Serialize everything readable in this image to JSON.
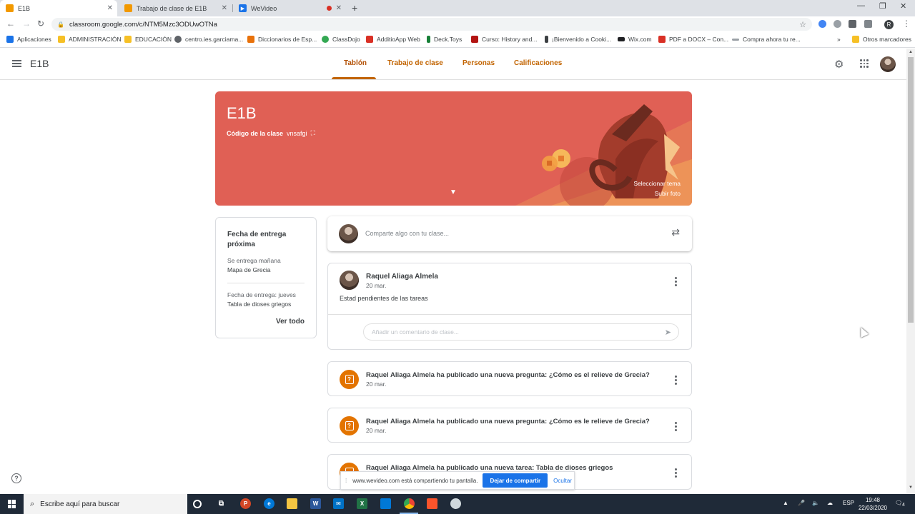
{
  "browser": {
    "tabs": [
      {
        "title": "E1B",
        "active": true,
        "favicon_color": "#f29900"
      },
      {
        "title": "Trabajo de clase de E1B",
        "active": false,
        "favicon_color": "#f29900"
      },
      {
        "title": "WeVideo",
        "active": false,
        "favicon_color": "#1a73e8"
      }
    ],
    "url": "classroom.google.com/c/NTM5Mzc3ODUwOTNa",
    "profile_initial": "R",
    "bookmarks": [
      {
        "label": "Aplicaciones",
        "icon_color": "#1a73e8"
      },
      {
        "label": "ADMINISTRACIÓN",
        "icon_color": "#f6c026"
      },
      {
        "label": "EDUCACIÓN",
        "icon_color": "#f6c026"
      },
      {
        "label": "centro.ies.garciama...",
        "icon_color": "#5f6368"
      },
      {
        "label": "Diccionarios de Esp...",
        "icon_color": "#e8710a"
      },
      {
        "label": "ClassDojo",
        "icon_color": "#34a853"
      },
      {
        "label": "AdditioApp Web",
        "icon_color": "#d93025"
      },
      {
        "label": "Deck.Toys",
        "icon_color": "#188038"
      },
      {
        "label": "Curso: History and...",
        "icon_color": "#b31412"
      },
      {
        "label": "¡Bienvenido a Cooki...",
        "icon_color": "#3c4043"
      },
      {
        "label": "Wix.com",
        "icon_color": "#202124"
      },
      {
        "label": "PDF a DOCX – Con...",
        "icon_color": "#d93025"
      },
      {
        "label": "Compra ahora tu re...",
        "icon_color": "#9aa0a6"
      }
    ],
    "other_bookmarks": "Otros marcadores"
  },
  "classroom": {
    "class_name": "E1B",
    "nav_tabs": [
      "Tablón",
      "Trabajo de clase",
      "Personas",
      "Calificaciones"
    ],
    "accent_color": "#c26401",
    "banner": {
      "title": "E1B",
      "code_label": "Código de la clase",
      "code_value": "vnsafgi",
      "select_theme": "Seleccionar tema",
      "upload_photo": "Subir foto",
      "color": "#e06055"
    },
    "upcoming": {
      "title": "Fecha de entrega próxima",
      "items": [
        {
          "when": "Se entrega mañana",
          "title": "Mapa de Grecia"
        },
        {
          "when": "Fecha de entrega: jueves",
          "title": "Tabla de dioses griegos"
        }
      ],
      "view_all": "Ver todo"
    },
    "share_placeholder": "Comparte algo con tu clase...",
    "post": {
      "author": "Raquel Aliaga Almela",
      "date": "20 mar.",
      "body": "Estad pendientes de las tareas",
      "comment_placeholder": "Añadir un comentario de clase..."
    },
    "activities": [
      {
        "text": "Raquel Aliaga Almela ha publicado una nueva pregunta: ¿Cómo es el relieve de Grecia?",
        "date": "20 mar.",
        "icon": "question-icon"
      },
      {
        "text": "Raquel Aliaga Almela ha publicado una nueva pregunta: ¿Cómo es le relieve de Grecia?",
        "date": "20 mar.",
        "icon": "question-icon"
      },
      {
        "text": "Raquel Aliaga Almela ha publicado una nueva tarea: Tabla de dioses griegos",
        "date": "",
        "icon": "assignment-icon"
      }
    ]
  },
  "share_notice": {
    "text": "www.wevideo.com está compartiendo tu pantalla.",
    "stop_label": "Dejar de compartir",
    "hide_label": "Ocultar"
  },
  "taskbar": {
    "search_placeholder": "Escribe aquí para buscar",
    "language": "ESP",
    "time": "19:48",
    "date": "22/03/2020",
    "notifications": "4"
  }
}
